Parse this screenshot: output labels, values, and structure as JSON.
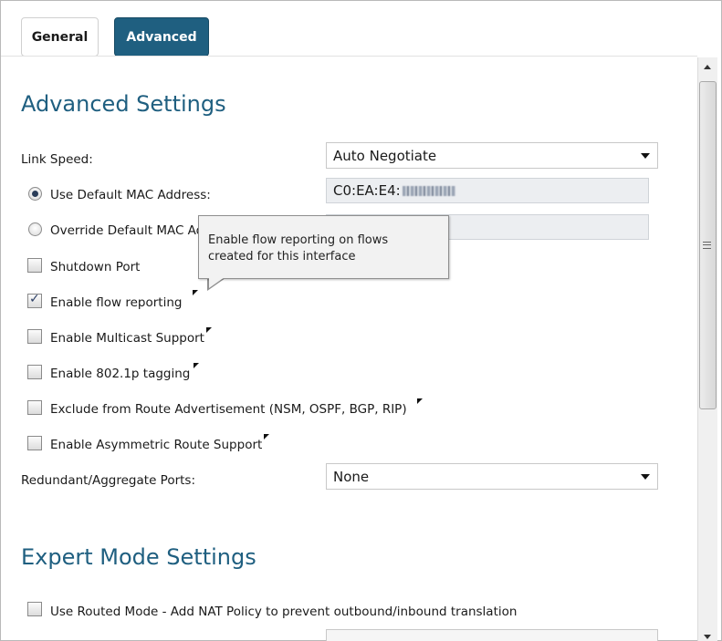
{
  "tabs": [
    {
      "label": "General",
      "active": false
    },
    {
      "label": "Advanced",
      "active": true
    }
  ],
  "advanced": {
    "heading": "Advanced Settings",
    "link_speed": {
      "label": "Link Speed:",
      "value": "Auto Negotiate"
    },
    "use_default_mac": {
      "label": "Use Default MAC Address:",
      "value_prefix": "C0:EA:E4:",
      "selected": true
    },
    "override_mac": {
      "label": "Override Default MAC Address:",
      "selected": false
    },
    "shutdown_port": {
      "label": "Shutdown Port",
      "checked": false
    },
    "flow_reporting": {
      "label": "Enable flow reporting",
      "checked": true
    },
    "multicast": {
      "label": "Enable Multicast Support",
      "checked": false
    },
    "tagging": {
      "label": "Enable 802.1p tagging",
      "checked": false
    },
    "exclude_route": {
      "label": "Exclude from Route Advertisement (NSM, OSPF, BGP, RIP)",
      "checked": false
    },
    "asymmetric": {
      "label": "Enable Asymmetric Route Support",
      "checked": false
    },
    "redundant": {
      "label": "Redundant/Aggregate Ports:",
      "value": "None"
    }
  },
  "tooltip": {
    "line1": "Enable flow reporting on flows",
    "line2": "created for this interface"
  },
  "expert": {
    "heading": "Expert Mode Settings",
    "routed_mode": {
      "label": "Use Routed Mode - Add NAT Policy to prevent outbound/inbound translation",
      "checked": false
    }
  },
  "colors": {
    "accent": "#1f5f80",
    "heading": "#1f5f80"
  }
}
